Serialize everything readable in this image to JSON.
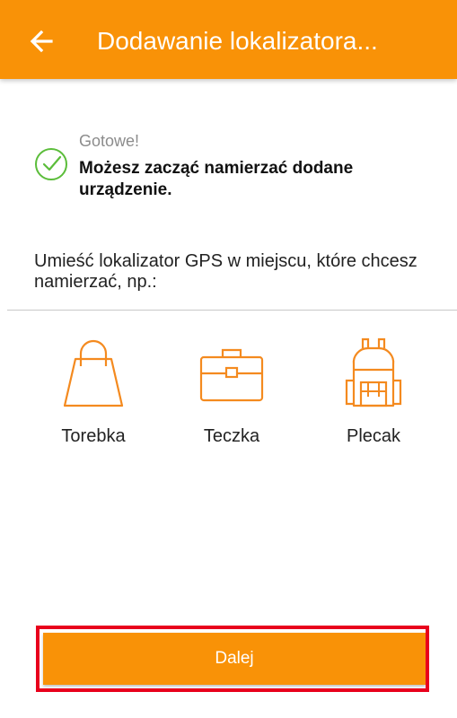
{
  "app_bar": {
    "title": "Dodawanie lokalizatora...",
    "back_icon": "arrow-left-icon",
    "color": "#f99207"
  },
  "success": {
    "icon": "check-circle-icon",
    "title": "Gotowe!",
    "message": "Możesz zacząć namierzać dodane urządzenie."
  },
  "instruction": "Umieść lokalizator GPS w miejscu, które chcesz namierzać, np.:",
  "options": [
    {
      "label": "Torebka",
      "icon": "handbag-icon"
    },
    {
      "label": "Teczka",
      "icon": "briefcase-icon"
    },
    {
      "label": "Plecak",
      "icon": "backpack-icon"
    }
  ],
  "next_button": {
    "label": "Dalej"
  },
  "colors": {
    "accent": "#f99207",
    "success": "#5bbd3a",
    "highlight": "#e8001c"
  }
}
